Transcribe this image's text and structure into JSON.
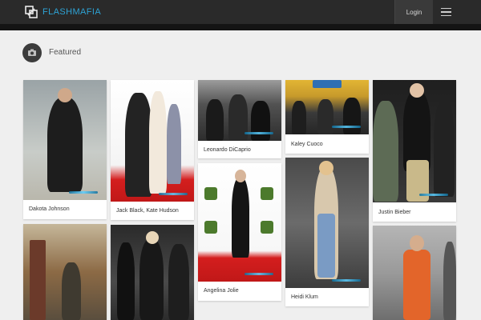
{
  "header": {
    "brand": "FLASHMAFIA",
    "login_label": "Login",
    "menu_icon": "hamburger-menu-icon",
    "logo_icon": "flashmafia-logo-icon",
    "colors": {
      "bar": "#2a2a2a",
      "brand": "#2ea3d5"
    }
  },
  "section": {
    "title": "Featured",
    "icon": "featured-camera-icon"
  },
  "cards": [
    {
      "caption": "Dakota Johnson"
    },
    {
      "caption": "Jack Black, Kate Hudson"
    },
    {
      "caption": "Leonardo DiCaprio"
    },
    {
      "caption": "Kaley Cuoco"
    },
    {
      "caption": "Justin Bieber"
    },
    {
      "caption": "Angelina Jolie"
    },
    {
      "caption": "Heidi Klum"
    },
    {
      "caption": ""
    },
    {
      "caption": ""
    },
    {
      "caption": ""
    }
  ]
}
